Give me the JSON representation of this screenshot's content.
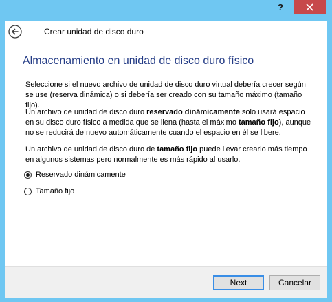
{
  "titlebar": {
    "help_label": "?",
    "close_icon": "close-icon"
  },
  "header": {
    "back_icon": "back-arrow-icon",
    "title": "Crear unidad de disco duro"
  },
  "page": {
    "title": "Almacenamiento en unidad de disco duro físico",
    "para1": "Seleccione si el nuevo archivo de unidad de disco duro virtual debería crecer según se use (reserva dinámica) o si debería ser creado con su tamaño máximo (tamaño fijo).",
    "para2_a": "Un archivo de unidad de disco duro ",
    "para2_b": "reservado dinámicamente",
    "para2_c": " solo usará espacio en su disco duro físico a medida que se llena (hasta el máximo ",
    "para2_d": "tamaño fijo",
    "para2_e": "), aunque no se reducirá de nuevo automáticamente cuando el espacio en él se libere.",
    "para3_a": "Un archivo de unidad de disco duro de ",
    "para3_b": "tamaño fijo",
    "para3_c": " puede llevar crearlo más tiempo en algunos sistemas pero normalmente es más rápido al usarlo."
  },
  "options": [
    {
      "label": "Reservado dinámicamente",
      "checked": true
    },
    {
      "label": "Tamaño fijo",
      "checked": false
    }
  ],
  "footer": {
    "next_label": "Next",
    "cancel_label": "Cancelar"
  }
}
